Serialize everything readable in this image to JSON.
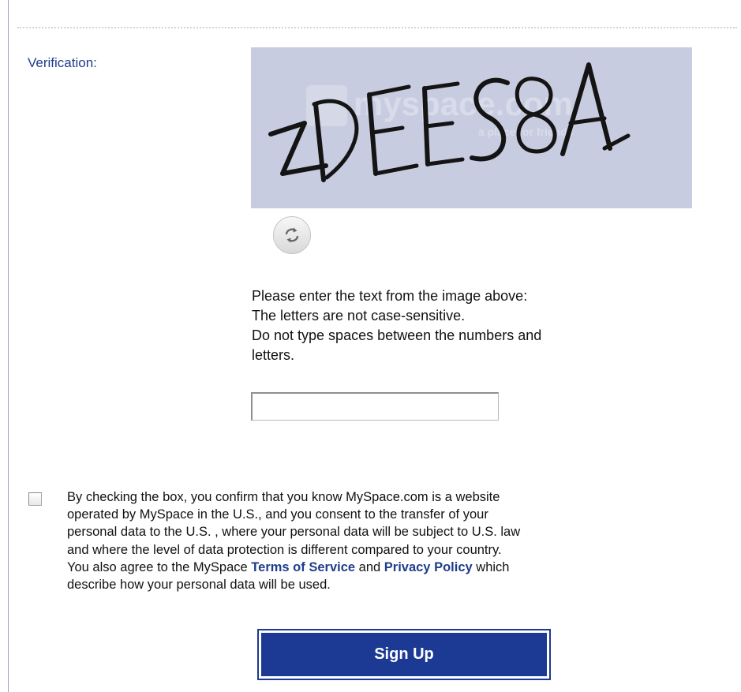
{
  "verification": {
    "label": "Verification:"
  },
  "captcha": {
    "text": "ZDEES8A",
    "watermark": "myspace.com",
    "watermark_sub": "a place for friends"
  },
  "instructions": {
    "line1": "Please enter the text from the image above:",
    "line2": "The letters are not case-sensitive.",
    "line3": "Do not type spaces between the numbers and",
    "line4": "letters."
  },
  "captcha_input": {
    "value": ""
  },
  "consent": {
    "line1": "By checking the box, you confirm that you know MySpace.com is a website",
    "line2": "operated by MySpace in the U.S., and you consent to the transfer of your",
    "line3": "personal data to the U.S. , where your personal data will be subject to U.S. law",
    "line4": "and where the level of data protection is different compared to your country.",
    "line5_pre": "You also agree to the MySpace ",
    "terms_link": "Terms of Service",
    "line5_mid": " and ",
    "privacy_link": "Privacy Policy",
    "line5_post": " which",
    "line6": "describe how your personal data will be used."
  },
  "signup": {
    "label": "Sign Up"
  },
  "icons": {
    "refresh": "refresh-icon",
    "checkbox": "checkbox-unchecked"
  }
}
